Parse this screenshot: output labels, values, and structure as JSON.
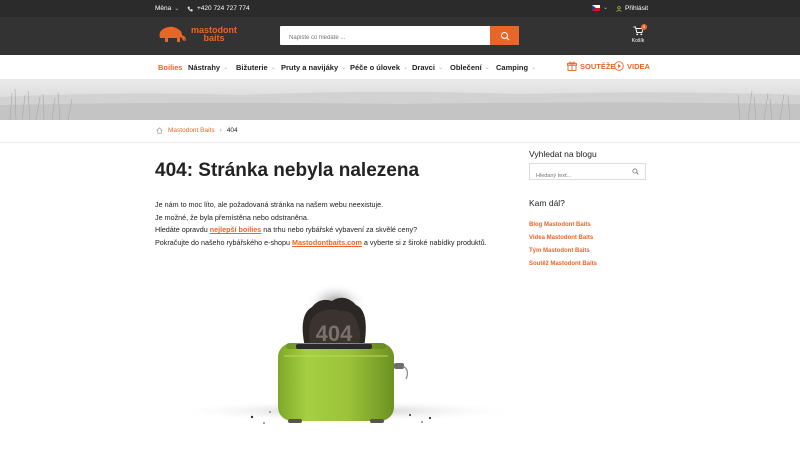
{
  "topbar": {
    "currency_label": "Měna",
    "phone": "+420 724 727 774",
    "login_label": "Přihlásit"
  },
  "header": {
    "logo_line1": "mastodont",
    "logo_line2": "baits",
    "search_placeholder": "Napište co hledáte ...",
    "cart_label": "Košík",
    "cart_count": "0"
  },
  "nav": {
    "items": [
      {
        "label": "Boilies"
      },
      {
        "label": "Nástrahy"
      },
      {
        "label": "Bižuterie"
      },
      {
        "label": "Pruty a navijáky"
      },
      {
        "label": "Péče o úlovek"
      },
      {
        "label": "Dravci"
      },
      {
        "label": "Oblečení"
      },
      {
        "label": "Camping"
      }
    ],
    "contests_label": "SOUTĚŽE",
    "videos_label": "VIDEA"
  },
  "breadcrumb": {
    "home": "Mastodont Baits",
    "current": "404"
  },
  "main": {
    "title": "404: Stránka nebyla nalezena",
    "p1": "Je nám to moc líto, ale požadovaná stránka na našem webu neexistuje.",
    "p2": "Je možné, že byla přemístěna nebo odstraněna.",
    "p3_before": "Hledáte opravdu ",
    "p3_link": "nejlepší boilies",
    "p3_after": " na trhu nebo rybářské vybavení za skvělé ceny?",
    "p4_before": "Pokračujte do našeho rybářského e-shopu ",
    "p4_link": "Mastodontbaits.com",
    "p4_after": " a vyberte si z široké nabídky produktů.",
    "toast_text": "404"
  },
  "sidebar": {
    "search_heading": "Vyhledat na blogu",
    "search_placeholder": "Hledaný text...",
    "next_heading": "Kam dál?",
    "links": [
      {
        "label": "Blog Mastodont Baits"
      },
      {
        "label": "Videa Mastodont Baits"
      },
      {
        "label": "Tým Mastodont Baits"
      },
      {
        "label": "Soutěž Mastodont Baits"
      }
    ]
  },
  "colors": {
    "accent": "#e8662a",
    "topbar": "#2b2b2b",
    "header": "#333333",
    "toaster": "#9cc33a"
  }
}
